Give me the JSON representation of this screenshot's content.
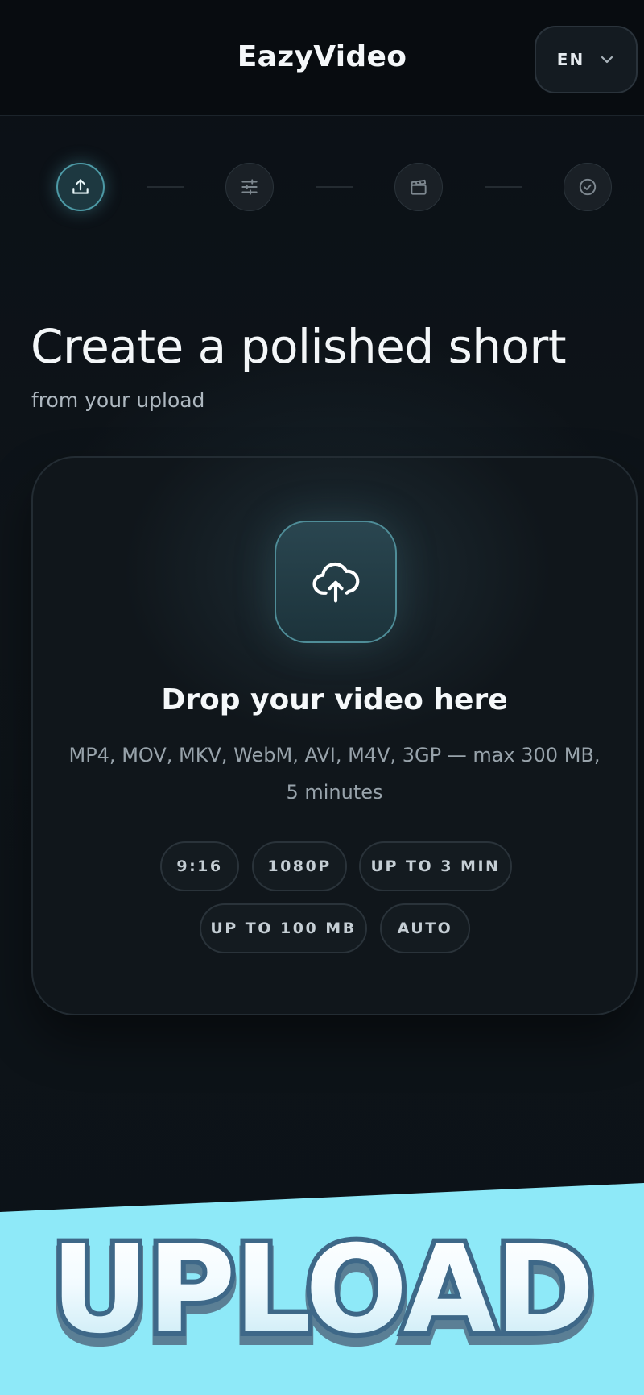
{
  "header": {
    "title": "EazyVideo",
    "language": {
      "code": "EN",
      "icon": "chevron-down-icon"
    }
  },
  "stepper": {
    "steps": [
      {
        "name": "upload",
        "icon": "upload-icon",
        "active": true
      },
      {
        "name": "settings",
        "icon": "sliders-icon",
        "active": false
      },
      {
        "name": "render",
        "icon": "clapperboard-icon",
        "active": false
      },
      {
        "name": "done",
        "icon": "check-circle-icon",
        "active": false
      }
    ]
  },
  "hero": {
    "title": "Create a polished short",
    "subtitle": "from your upload"
  },
  "dropzone": {
    "icon": "cloud-upload-icon",
    "title": "Drop your video here",
    "description": "MP4, MOV, MKV, WebM, AVI, M4V, 3GP — max 300 MB, 5 minutes",
    "chips": [
      "9:16",
      "1080P",
      "UP TO 3 MIN",
      "UP TO 100 MB",
      "AUTO"
    ]
  },
  "banner": {
    "label": "UPLOAD"
  },
  "colors": {
    "accent": "#4d9aa6",
    "background": "#0b1016",
    "banner": "#8ee9f8",
    "banner_text_outline": "#3e6888"
  }
}
